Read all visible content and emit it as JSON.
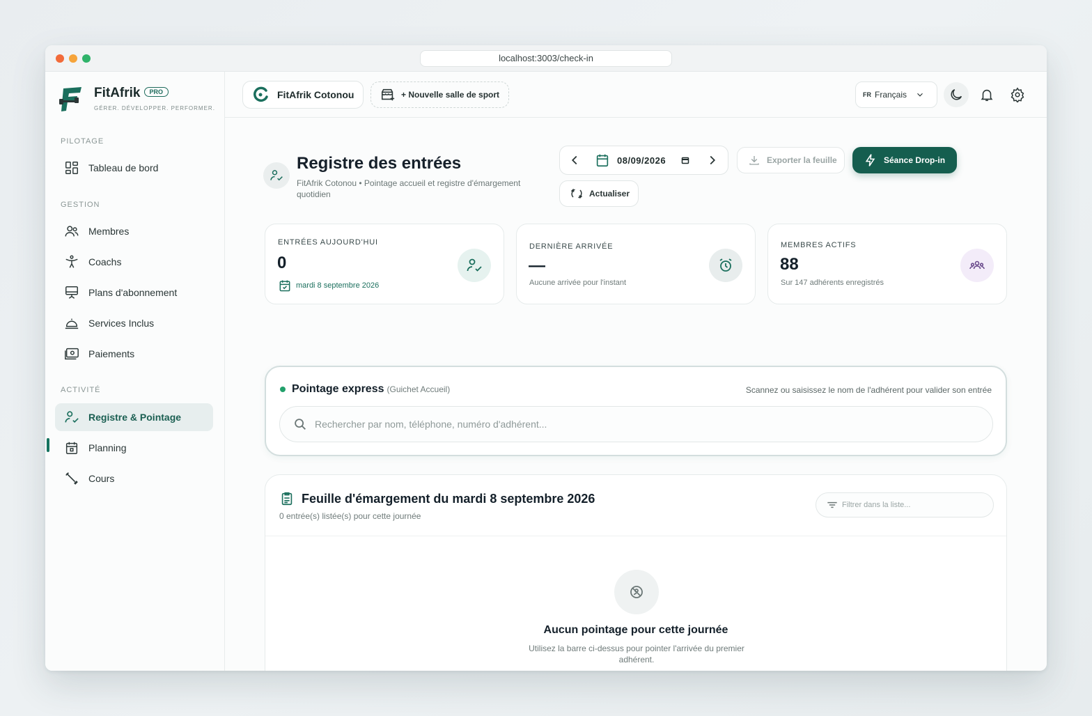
{
  "browser": {
    "url": "localhost:3003/check-in"
  },
  "brand": {
    "name": "FitAfrik",
    "badge": "PRO",
    "tagline": "GÉRER. DÉVELOPPER. PERFORMER."
  },
  "sidebar": {
    "sections": [
      {
        "label": "PILOTAGE",
        "items": [
          {
            "label": "Tableau de bord",
            "icon": "dashboard-icon"
          }
        ]
      },
      {
        "label": "GESTION",
        "items": [
          {
            "label": "Membres",
            "icon": "users-icon"
          },
          {
            "label": "Coachs",
            "icon": "coach-icon"
          },
          {
            "label": "Plans d'abonnement",
            "icon": "subscription-icon"
          },
          {
            "label": "Services Inclus",
            "icon": "service-bell-icon"
          },
          {
            "label": "Paiements",
            "icon": "payment-icon"
          }
        ]
      },
      {
        "label": "ACTIVITÉ",
        "items": [
          {
            "label": "Registre & Pointage",
            "icon": "user-check-icon",
            "active": true
          },
          {
            "label": "Planning",
            "icon": "calendar-icon"
          },
          {
            "label": "Cours",
            "icon": "dumbbell-icon"
          }
        ]
      }
    ]
  },
  "topbar": {
    "gym_name": "FitAfrik Cotonou",
    "new_gym_label": "+ Nouvelle salle de sport",
    "language_code": "FR",
    "language_label": "Français"
  },
  "page": {
    "title": "Registre des entrées",
    "subtitle": "FitAfrik Cotonou • Pointage accueil et registre d'émargement quotidien",
    "date": "08/09/2026",
    "export_label": "Exporter la feuille",
    "dropin_label": "Séance Drop-in",
    "refresh_label": "Actualiser"
  },
  "stats": [
    {
      "label": "ENTRÉES AUJOURD'HUI",
      "value": "0",
      "sub": "mardi 8 septembre 2026",
      "icon": "user-check-icon",
      "accent": "#e6f2ef"
    },
    {
      "label": "DERNIÈRE ARRIVÉE",
      "value": "—",
      "sub": "Aucune arrivée pour l'instant",
      "icon": "alarm-clock-icon",
      "accent": "#e8eded"
    },
    {
      "label": "MEMBRES ACTIFS",
      "value": "88",
      "sub": "Sur 147 adhérents enregistrés",
      "icon": "group-icon",
      "accent": "#f3ecf9"
    }
  ],
  "express": {
    "title": "Pointage express",
    "subtitle": "(Guichet Accueil)",
    "hint": "Scannez ou saisissez le nom de l'adhérent pour valider son entrée",
    "search_placeholder": "Rechercher par nom, téléphone, numéro d'adhérent..."
  },
  "sheet": {
    "title": "Feuille d'émargement du mardi 8 septembre 2026",
    "count_text": "0 entrée(s) listée(s) pour cette journée",
    "filter_placeholder": "Filtrer dans la liste...",
    "empty_title": "Aucun pointage pour cette journée",
    "empty_sub": "Utilisez la barre ci-dessus pour pointer l'arrivée du premier adhérent."
  },
  "colors": {
    "brand": "#155e4f",
    "accent_green": "#22a06b",
    "active_bg": "#e7eeee"
  }
}
